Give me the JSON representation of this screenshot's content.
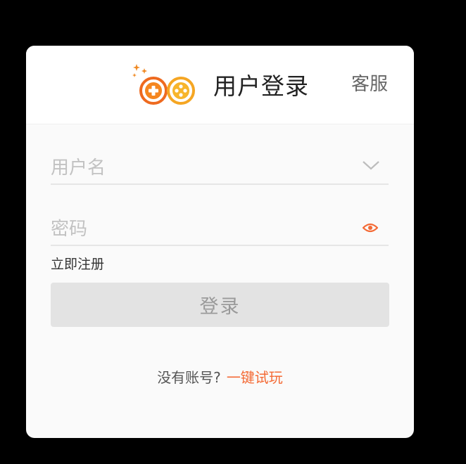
{
  "dialog": {
    "title": "用户登录",
    "service_link": "客服"
  },
  "form": {
    "username_placeholder": "用户名",
    "password_placeholder": "密码",
    "register_link": "立即注册",
    "login_button": "登录"
  },
  "footer": {
    "no_account_prompt": "没有账号?",
    "trial_link": "一键试玩"
  },
  "icons": {
    "logo": "gamepad-plus-logo-icon",
    "username_dropdown": "chevron-down-icon",
    "password_toggle": "eye-icon"
  },
  "colors": {
    "accent": "#f46a35",
    "logo_orange": "#f08a24",
    "logo_yellow": "#f7b52c",
    "button_disabled_bg": "#e3e3e3"
  }
}
